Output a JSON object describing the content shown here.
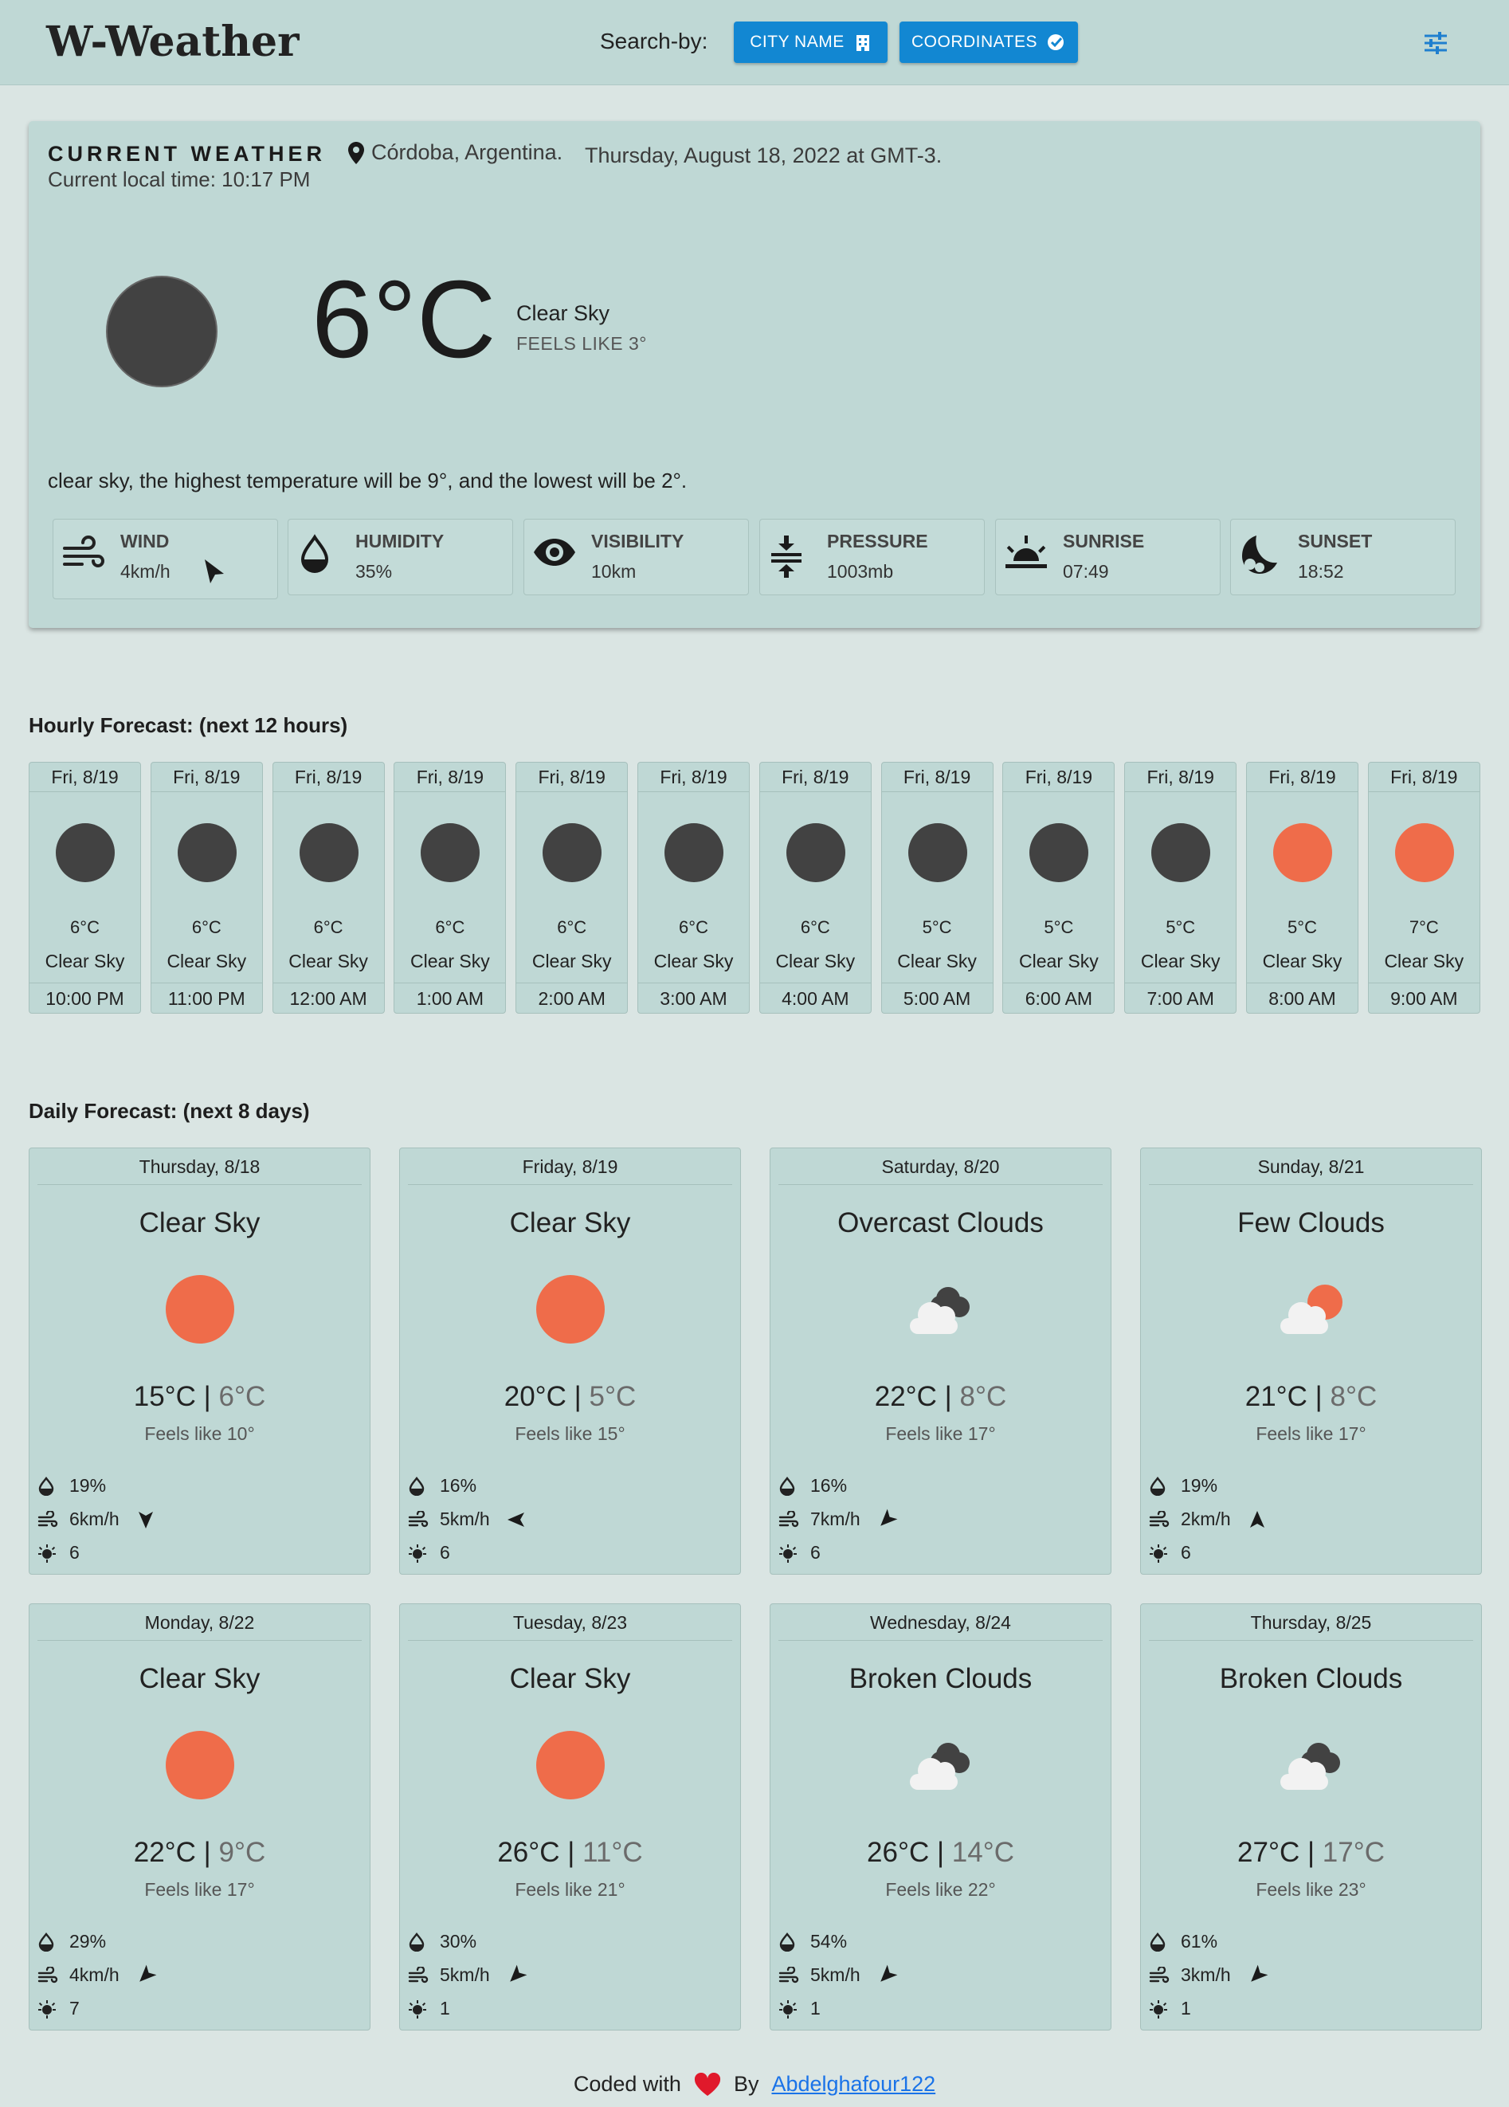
{
  "header": {
    "logo": "W-Weather",
    "search_label": "Search-by:",
    "city_button": "CITY NAME",
    "coords_button": "COORDINATES"
  },
  "current": {
    "title": "CURRENT WEATHER",
    "location": "Córdoba, Argentina.",
    "date": "Thursday, August 18, 2022 at GMT-3.",
    "local_time": "Current local time: 10:17 PM",
    "temp": "6°C",
    "description": "Clear Sky",
    "feels_like": "FEELS LIKE 3°",
    "summary": "clear sky, the highest temperature will be 9°, and the lowest will be 2°.",
    "stats": [
      {
        "label": "WIND",
        "value": "4km/h",
        "icon": "wind-icon"
      },
      {
        "label": "HUMIDITY",
        "value": "35%",
        "icon": "humidity-drop-icon"
      },
      {
        "label": "VISIBILITY",
        "value": "10km",
        "icon": "eye-icon"
      },
      {
        "label": "PRESSURE",
        "value": "1003mb",
        "icon": "pressure-icon"
      },
      {
        "label": "SUNRISE",
        "value": "07:49",
        "icon": "sunrise-icon"
      },
      {
        "label": "SUNSET",
        "value": "18:52",
        "icon": "moon-icon"
      }
    ]
  },
  "hourly": {
    "title": "Hourly Forecast: (next 12 hours)",
    "items": [
      {
        "date": "Fri, 8/19",
        "temp": "6°C",
        "desc": "Clear Sky",
        "time": "10:00 PM",
        "icon": "moon"
      },
      {
        "date": "Fri, 8/19",
        "temp": "6°C",
        "desc": "Clear Sky",
        "time": "11:00 PM",
        "icon": "moon"
      },
      {
        "date": "Fri, 8/19",
        "temp": "6°C",
        "desc": "Clear Sky",
        "time": "12:00 AM",
        "icon": "moon"
      },
      {
        "date": "Fri, 8/19",
        "temp": "6°C",
        "desc": "Clear Sky",
        "time": "1:00 AM",
        "icon": "moon"
      },
      {
        "date": "Fri, 8/19",
        "temp": "6°C",
        "desc": "Clear Sky",
        "time": "2:00 AM",
        "icon": "moon"
      },
      {
        "date": "Fri, 8/19",
        "temp": "6°C",
        "desc": "Clear Sky",
        "time": "3:00 AM",
        "icon": "moon"
      },
      {
        "date": "Fri, 8/19",
        "temp": "6°C",
        "desc": "Clear Sky",
        "time": "4:00 AM",
        "icon": "moon"
      },
      {
        "date": "Fri, 8/19",
        "temp": "5°C",
        "desc": "Clear Sky",
        "time": "5:00 AM",
        "icon": "moon"
      },
      {
        "date": "Fri, 8/19",
        "temp": "5°C",
        "desc": "Clear Sky",
        "time": "6:00 AM",
        "icon": "moon"
      },
      {
        "date": "Fri, 8/19",
        "temp": "5°C",
        "desc": "Clear Sky",
        "time": "7:00 AM",
        "icon": "moon"
      },
      {
        "date": "Fri, 8/19",
        "temp": "5°C",
        "desc": "Clear Sky",
        "time": "8:00 AM",
        "icon": "sun"
      },
      {
        "date": "Fri, 8/19",
        "temp": "7°C",
        "desc": "Clear Sky",
        "time": "9:00 AM",
        "icon": "sun"
      }
    ]
  },
  "daily": {
    "title": "Daily Forecast: (next 8 days)",
    "items": [
      {
        "date": "Thursday, 8/18",
        "desc": "Clear Sky",
        "icon": "sun",
        "high": "15°C",
        "low": "6°C",
        "feels": "Feels like 10°",
        "humidity": "19%",
        "wind": "6km/h",
        "wind_dir_deg": 180,
        "uv": "6"
      },
      {
        "date": "Friday, 8/19",
        "desc": "Clear Sky",
        "icon": "sun",
        "high": "20°C",
        "low": "5°C",
        "feels": "Feels like 15°",
        "humidity": "16%",
        "wind": "5km/h",
        "wind_dir_deg": 270,
        "uv": "6"
      },
      {
        "date": "Saturday, 8/20",
        "desc": "Overcast Clouds",
        "icon": "clouds",
        "high": "22°C",
        "low": "8°C",
        "feels": "Feels like 17°",
        "humidity": "16%",
        "wind": "7km/h",
        "wind_dir_deg": 225,
        "uv": "6"
      },
      {
        "date": "Sunday, 8/21",
        "desc": "Few Clouds",
        "icon": "few-clouds",
        "high": "21°C",
        "low": "8°C",
        "feels": "Feels like 17°",
        "humidity": "19%",
        "wind": "2km/h",
        "wind_dir_deg": 0,
        "uv": "6"
      },
      {
        "date": "Monday, 8/22",
        "desc": "Clear Sky",
        "icon": "sun",
        "high": "22°C",
        "low": "9°C",
        "feels": "Feels like 17°",
        "humidity": "29%",
        "wind": "4km/h",
        "wind_dir_deg": 225,
        "uv": "7"
      },
      {
        "date": "Tuesday, 8/23",
        "desc": "Clear Sky",
        "icon": "sun",
        "high": "26°C",
        "low": "11°C",
        "feels": "Feels like 21°",
        "humidity": "30%",
        "wind": "5km/h",
        "wind_dir_deg": 225,
        "uv": "1"
      },
      {
        "date": "Wednesday, 8/24",
        "desc": "Broken Clouds",
        "icon": "clouds",
        "high": "26°C",
        "low": "14°C",
        "feels": "Feels like 22°",
        "humidity": "54%",
        "wind": "5km/h",
        "wind_dir_deg": 225,
        "uv": "1"
      },
      {
        "date": "Thursday, 8/25",
        "desc": "Broken Clouds",
        "icon": "clouds",
        "high": "27°C",
        "low": "17°C",
        "feels": "Feels like 23°",
        "humidity": "61%",
        "wind": "3km/h",
        "wind_dir_deg": 225,
        "uv": "1"
      }
    ]
  },
  "footer": {
    "coded_with": "Coded with",
    "by": "By",
    "author": "Abdelghafour122"
  },
  "colors": {
    "moon": "#424242",
    "sun": "#ef6c4a",
    "accent": "#1287d2"
  }
}
